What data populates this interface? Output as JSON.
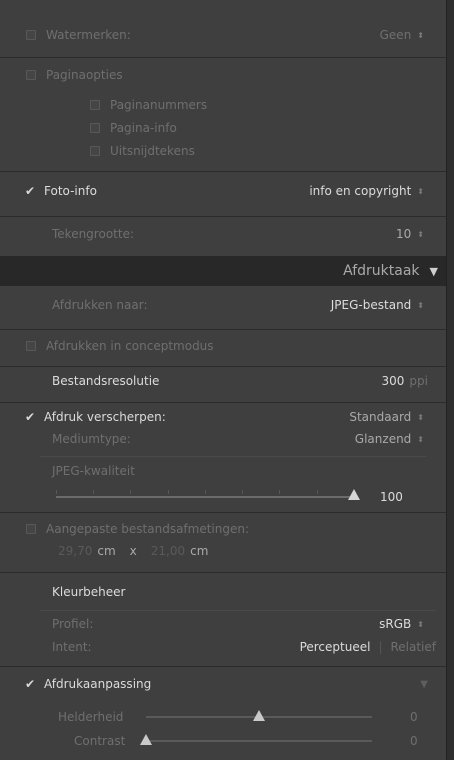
{
  "watermark": {
    "label": "Watermerken:",
    "value": "Geen"
  },
  "page_options": {
    "label": "Paginaopties",
    "items": [
      "Paginanummers",
      "Pagina-info",
      "Uitsnijdtekens"
    ]
  },
  "photo_info": {
    "label": "Foto-info",
    "value": "info en copyright"
  },
  "font_size": {
    "label": "Tekengrootte:",
    "value": "10"
  },
  "print_job": {
    "header": "Afdruktaak",
    "print_to_label": "Afdrukken naar:",
    "print_to_value": "JPEG-bestand",
    "draft_mode": "Afdrukken in conceptmodus",
    "resolution_label": "Bestandsresolutie",
    "resolution_value": "300",
    "resolution_unit": "ppi",
    "sharpen_label": "Afdruk verscherpen:",
    "sharpen_value": "Standaard",
    "media_label": "Mediumtype:",
    "media_value": "Glanzend",
    "jpeg_label": "JPEG-kwaliteit",
    "jpeg_value": "100",
    "jpeg_fraction": 1.0,
    "custom_dims_label": "Aangepaste bestandsafmetingen:",
    "dim_w": "29,70",
    "dim_h": "21,00",
    "dim_unit": "cm",
    "dim_x": "x"
  },
  "color": {
    "header": "Kleurbeheer",
    "profile_label": "Profiel:",
    "profile_value": "sRGB",
    "intent_label": "Intent:",
    "intent_perceptual": "Perceptueel",
    "intent_sep": "|",
    "intent_relative": "Relatief"
  },
  "adjust": {
    "label": "Afdrukaanpassing",
    "brightness_label": "Helderheid",
    "brightness_value": "0",
    "brightness_fraction": 0.5,
    "contrast_label": "Contrast",
    "contrast_value": "0",
    "contrast_fraction": 0.0
  },
  "glyphs": {
    "check": "✔",
    "updown": "⬍",
    "triangle_down": "▼"
  }
}
